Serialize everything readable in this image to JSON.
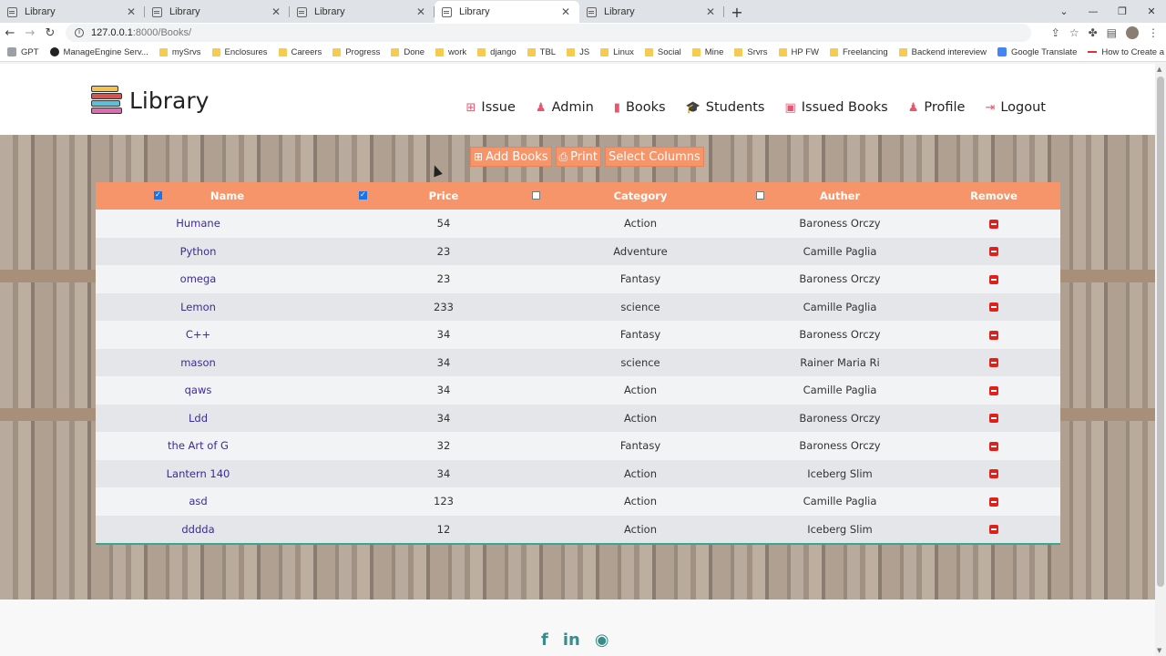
{
  "browser": {
    "tabs": [
      {
        "title": "Library",
        "active": false
      },
      {
        "title": "Library",
        "active": false
      },
      {
        "title": "Library",
        "active": false
      },
      {
        "title": "Library",
        "active": true
      },
      {
        "title": "Library",
        "active": false
      }
    ],
    "url_host": "127.0.0.1",
    "url_path": ":8000/Books/",
    "bookmarks": [
      {
        "label": "GPT",
        "icon": "globe"
      },
      {
        "label": "ManageEngine Serv...",
        "icon": "sd"
      },
      {
        "label": "mySrvs",
        "icon": "folder"
      },
      {
        "label": "Enclosures",
        "icon": "folder"
      },
      {
        "label": "Careers",
        "icon": "folder"
      },
      {
        "label": "Progress",
        "icon": "folder"
      },
      {
        "label": "Done",
        "icon": "folder"
      },
      {
        "label": "work",
        "icon": "folder"
      },
      {
        "label": "django",
        "icon": "folder"
      },
      {
        "label": "TBL",
        "icon": "folder"
      },
      {
        "label": "JS",
        "icon": "folder"
      },
      {
        "label": "Linux",
        "icon": "folder"
      },
      {
        "label": "Social",
        "icon": "folder"
      },
      {
        "label": "Mine",
        "icon": "folder"
      },
      {
        "label": "Srvrs",
        "icon": "folder"
      },
      {
        "label": "HP FW",
        "icon": "folder"
      },
      {
        "label": "Freelancing",
        "icon": "folder"
      },
      {
        "label": "Backend intereview",
        "icon": "folder"
      },
      {
        "label": "Google Translate",
        "icon": "gt"
      },
      {
        "label": "How to Create a W...",
        "icon": "dash"
      }
    ]
  },
  "site": {
    "brand": "Library",
    "nav": [
      {
        "label": "Issue",
        "icon": "plus-square-icon",
        "glyph": "⊞"
      },
      {
        "label": "Admin",
        "icon": "user-icon",
        "glyph": "♟"
      },
      {
        "label": "Books",
        "icon": "book-icon",
        "glyph": "▮"
      },
      {
        "label": "Students",
        "icon": "graduation-cap-icon",
        "glyph": "🎓"
      },
      {
        "label": "Issued Books",
        "icon": "id-badge-icon",
        "glyph": "▣"
      },
      {
        "label": "Profile",
        "icon": "user-icon",
        "glyph": "♟"
      },
      {
        "label": "Logout",
        "icon": "sign-out-icon",
        "glyph": "⇥"
      }
    ],
    "accent": "#f6956a",
    "icon_color": "#e8566f"
  },
  "toolbar": {
    "add_books": "Add Books",
    "print": "Print",
    "select_columns": "Select Columns"
  },
  "table": {
    "headers": [
      {
        "label": "Name",
        "checkbox": true,
        "checked": true
      },
      {
        "label": "Price",
        "checkbox": true,
        "checked": true
      },
      {
        "label": "Category",
        "checkbox": true,
        "checked": false
      },
      {
        "label": "Auther",
        "checkbox": true,
        "checked": false
      },
      {
        "label": "Remove",
        "checkbox": false,
        "checked": false
      }
    ],
    "rows": [
      {
        "name": "Humane",
        "price": "54",
        "category": "Action",
        "author": "Baroness Orczy"
      },
      {
        "name": "Python",
        "price": "23",
        "category": "Adventure",
        "author": "Camille Paglia"
      },
      {
        "name": "omega",
        "price": "23",
        "category": "Fantasy",
        "author": "Baroness Orczy"
      },
      {
        "name": "Lemon",
        "price": "233",
        "category": "science",
        "author": "Camille Paglia"
      },
      {
        "name": "C++",
        "price": "34",
        "category": "Fantasy",
        "author": "Baroness Orczy"
      },
      {
        "name": "mason",
        "price": "34",
        "category": "science",
        "author": "Rainer Maria Ri"
      },
      {
        "name": "qaws",
        "price": "34",
        "category": "Action",
        "author": "Camille Paglia"
      },
      {
        "name": "Ldd",
        "price": "34",
        "category": "Action",
        "author": "Baroness Orczy"
      },
      {
        "name": "the Art of G",
        "price": "32",
        "category": "Fantasy",
        "author": "Baroness Orczy"
      },
      {
        "name": "Lantern 140",
        "price": "34",
        "category": "Action",
        "author": "Iceberg Slim"
      },
      {
        "name": "asd",
        "price": "123",
        "category": "Action",
        "author": "Camille Paglia"
      },
      {
        "name": "dddda",
        "price": "12",
        "category": "Action",
        "author": "Iceberg Slim"
      }
    ]
  },
  "footer": {
    "social": [
      {
        "icon": "facebook-icon",
        "glyph": "f"
      },
      {
        "icon": "linkedin-icon",
        "glyph": "in"
      },
      {
        "icon": "github-icon",
        "glyph": "◉"
      }
    ]
  }
}
